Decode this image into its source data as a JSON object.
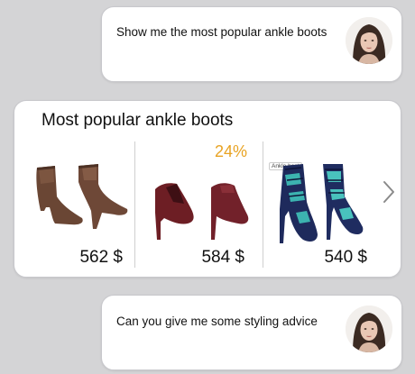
{
  "messages": [
    {
      "text": "Show me the most popular ankle boots",
      "avatar": "user-avatar-woman"
    },
    {
      "text": "Can you give me some styling advice",
      "avatar": "user-avatar-woman"
    }
  ],
  "card": {
    "title": "Most popular ankle boots",
    "products": [
      {
        "price": "562 $",
        "image": "brown-leather-ankle-boots"
      },
      {
        "price": "584 $",
        "badge": "24%",
        "image": "burgundy-heeled-ankle-boots"
      },
      {
        "price": "540 $",
        "tag": "Ankle boot",
        "image": "blue-teal-lace-up-heels"
      }
    ],
    "next_icon": "chevron-right-icon"
  },
  "colors": {
    "badge": "#e8a323",
    "background": "#d4d4d6"
  }
}
